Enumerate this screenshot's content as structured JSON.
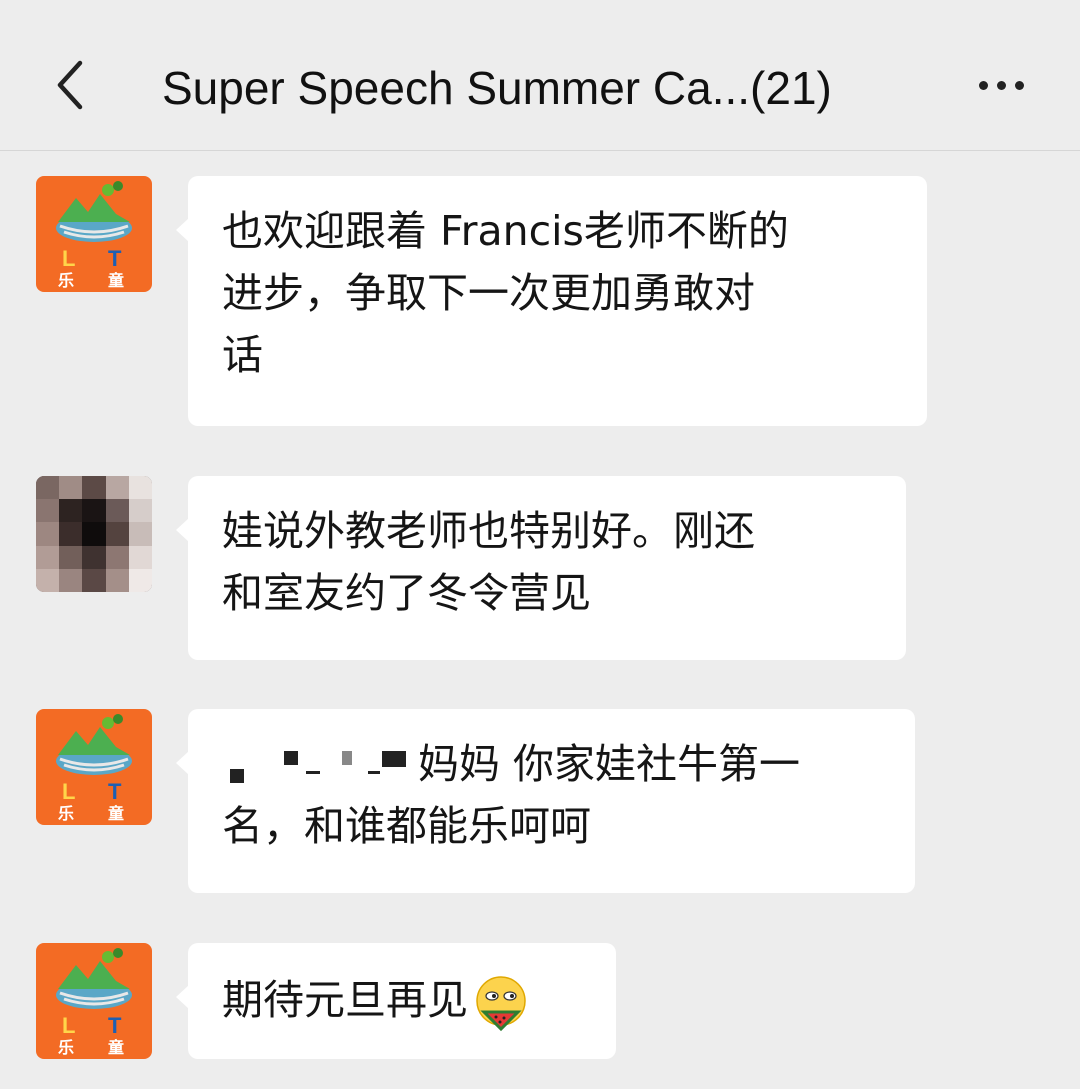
{
  "header": {
    "title": "Super Speech Summer Ca...(21)"
  },
  "avatars": {
    "logo_text": {
      "left": "L",
      "right": "T",
      "bottom_left": "乐",
      "bottom_right": "童"
    }
  },
  "messages": [
    {
      "text_lines": [
        "也欢迎跟着 Francis老师不断的",
        "进步，争取下一次更加勇敢对",
        "话"
      ]
    },
    {
      "text_lines": [
        "娃说外教老师也特别好。刚还",
        "和室友约了冬令营见"
      ]
    },
    {
      "text_after_redaction": "妈妈 你家娃社牛第一",
      "line2": "名，和谁都能乐呵呵"
    },
    {
      "text": "期待元旦再见"
    }
  ],
  "colors": {
    "background": "#ededed",
    "bubble": "#ffffff",
    "logo_bg": "#f36b24"
  }
}
